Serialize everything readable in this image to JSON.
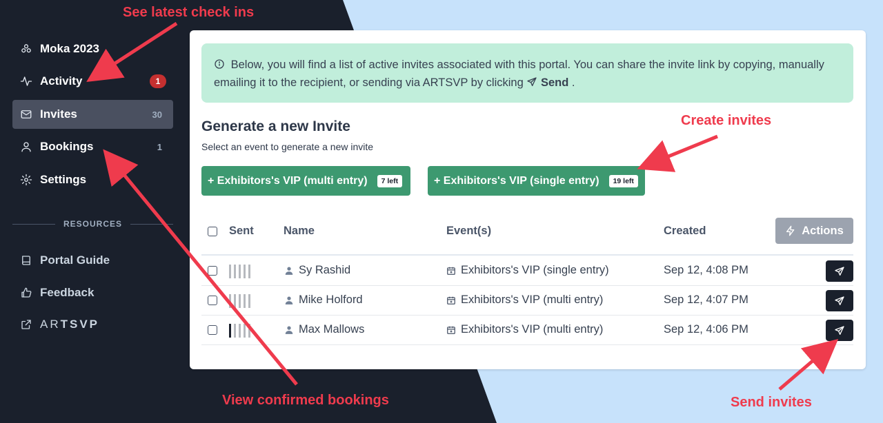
{
  "sidebar": {
    "items": [
      {
        "label": "Moka 2023",
        "icon": "gift-icon"
      },
      {
        "label": "Activity",
        "icon": "activity-icon",
        "badge": "1"
      },
      {
        "label": "Invites",
        "icon": "mail-icon",
        "count": "30"
      },
      {
        "label": "Bookings",
        "icon": "user-icon",
        "count": "1"
      },
      {
        "label": "Settings",
        "icon": "gear-icon"
      }
    ],
    "section_label": "RESOURCES",
    "resources": [
      {
        "label": "Portal Guide",
        "icon": "book-icon"
      },
      {
        "label": "Feedback",
        "icon": "thumbs-up-icon"
      }
    ],
    "brand": {
      "light": "AR",
      "bold": "TSVP"
    }
  },
  "info": {
    "text": "Below, you will find a list of active invites associated with this portal. You can share the invite link by copying, manually emailing it to the recipient, or sending via ARTSVP by clicking",
    "send_word": "Send",
    "tail": "."
  },
  "generate": {
    "title": "Generate a new Invite",
    "subtitle": "Select an event to generate a new invite",
    "buttons": [
      {
        "label": "+ Exhibitors's VIP (multi entry)",
        "left": "7 left"
      },
      {
        "label": "+ Exhibitors's VIP (single entry)",
        "left": "19 left"
      }
    ]
  },
  "table": {
    "headers": {
      "sent": "Sent",
      "name": "Name",
      "events": "Event(s)",
      "created": "Created",
      "actions": "Actions"
    },
    "rows": [
      {
        "name": "Sy Rashid",
        "event": "Exhibitors's VIP (single entry)",
        "created": "Sep 12, 4:08 PM",
        "sent_level": 0
      },
      {
        "name": "Mike Holford",
        "event": "Exhibitors's VIP (multi entry)",
        "created": "Sep 12, 4:07 PM",
        "sent_level": 0
      },
      {
        "name": "Max Mallows",
        "event": "Exhibitors's VIP (multi entry)",
        "created": "Sep 12, 4:06 PM",
        "sent_level": 1
      }
    ]
  },
  "annotations": {
    "checkins": "See latest check ins",
    "create": "Create invites",
    "bookings": "View confirmed bookings",
    "send": "Send invites"
  },
  "colors": {
    "accent_green": "#3d9970",
    "annotation_red": "#ef3b4d",
    "sidebar_bg": "#1a202c"
  }
}
